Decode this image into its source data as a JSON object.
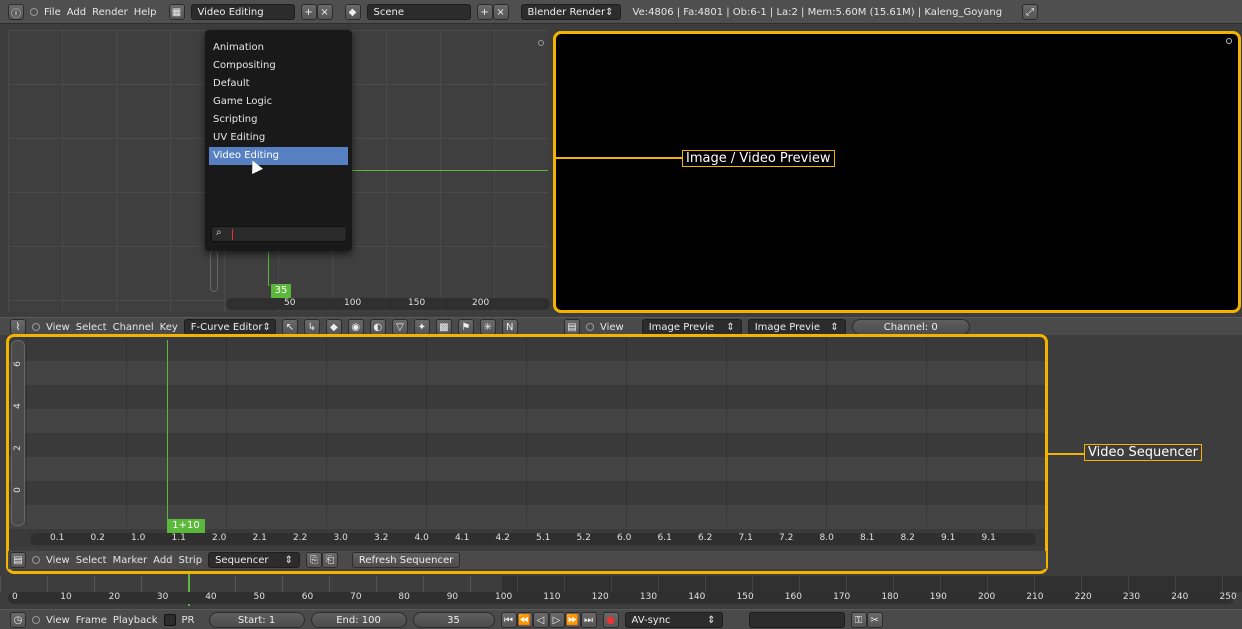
{
  "top_bar": {
    "menus": [
      "File",
      "Add",
      "Render",
      "Help"
    ],
    "layout_value": "Video Editing",
    "scene_value": "Scene",
    "engine_value": "Blender Render",
    "stats": "Ve:4806 | Fa:4801 | Ob:6-1 | La:2 | Mem:5.60M (15.61M) | Kaleng_Goyang"
  },
  "layout_menu": {
    "items": [
      "Animation",
      "Compositing",
      "Default",
      "Game Logic",
      "Scripting",
      "UV Editing",
      "Video Editing"
    ],
    "selected_index": 6
  },
  "graph_editor": {
    "current_frame": "35",
    "x_ticks": [
      "50",
      "100",
      "150",
      "200"
    ],
    "header": {
      "menus": [
        "View",
        "Select",
        "Channel",
        "Key"
      ],
      "mode": "F-Curve Editor"
    }
  },
  "preview": {
    "annotation": "Image / Video Preview",
    "header": {
      "menus": [
        "View"
      ],
      "display1": "Image Previe",
      "display2": "Image Previe",
      "channel": "Channel: 0"
    }
  },
  "sequencer": {
    "annotation": "Video Sequencer",
    "current_frame": "1+10",
    "y_ticks": [
      "6",
      "4",
      "2",
      "0"
    ],
    "x_ticks": [
      "0.1",
      "0.2",
      "1.0",
      "1.1",
      "2.0",
      "2.1",
      "2.2",
      "3.0",
      "3.2",
      "4.0",
      "4.1",
      "4.2",
      "5.1",
      "5.2",
      "6.0",
      "6.1",
      "6.2",
      "7.1",
      "7.2",
      "8.0",
      "8.1",
      "8.2",
      "9.1",
      "9.1"
    ],
    "header": {
      "menus": [
        "View",
        "Select",
        "Marker",
        "Add",
        "Strip"
      ],
      "mode": "Sequencer",
      "refresh_label": "Refresh Sequencer"
    }
  },
  "timeline": {
    "ticks": [
      "0",
      "10",
      "20",
      "30",
      "40",
      "50",
      "60",
      "70",
      "80",
      "90",
      "100",
      "110",
      "120",
      "130",
      "140",
      "150",
      "160",
      "170",
      "180",
      "190",
      "200",
      "210",
      "220",
      "230",
      "240",
      "250"
    ],
    "header": {
      "menus": [
        "View",
        "Frame",
        "Playback"
      ],
      "pr_label": "PR",
      "start_label": "Start: 1",
      "end_label": "End: 100",
      "current": "35",
      "sync": "AV-sync"
    }
  },
  "colors": {
    "accent": "#f5b301",
    "selected": "#5680c2",
    "frame_marker": "#5ab83a"
  }
}
